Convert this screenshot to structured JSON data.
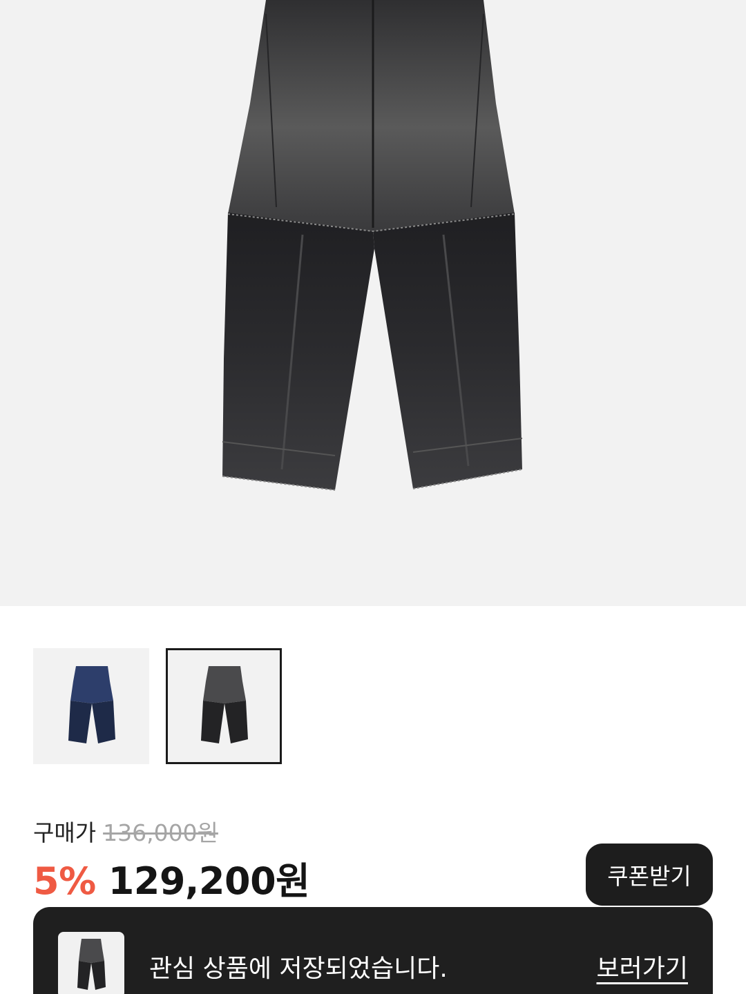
{
  "product": {
    "hero_image": "black-washed-wide-denim-pants",
    "thumbnails": [
      {
        "name": "blue-denim-pants",
        "color": "#2b3a5e",
        "selected": false
      },
      {
        "name": "black-denim-pants",
        "color": "#2a2a2c",
        "selected": true
      }
    ]
  },
  "price": {
    "label": "구매가",
    "original": "136,000원",
    "discount": "5%",
    "sale": "129,200원"
  },
  "coupon_button": "쿠폰받기",
  "toast": {
    "message": "관심 상품에 저장되었습니다.",
    "link": "보러가기"
  },
  "colors": {
    "discount": "#ef5a43",
    "dark_button": "#1d1d1d",
    "toast_bg": "#1f1f1f",
    "image_bg": "#f2f2f2"
  }
}
